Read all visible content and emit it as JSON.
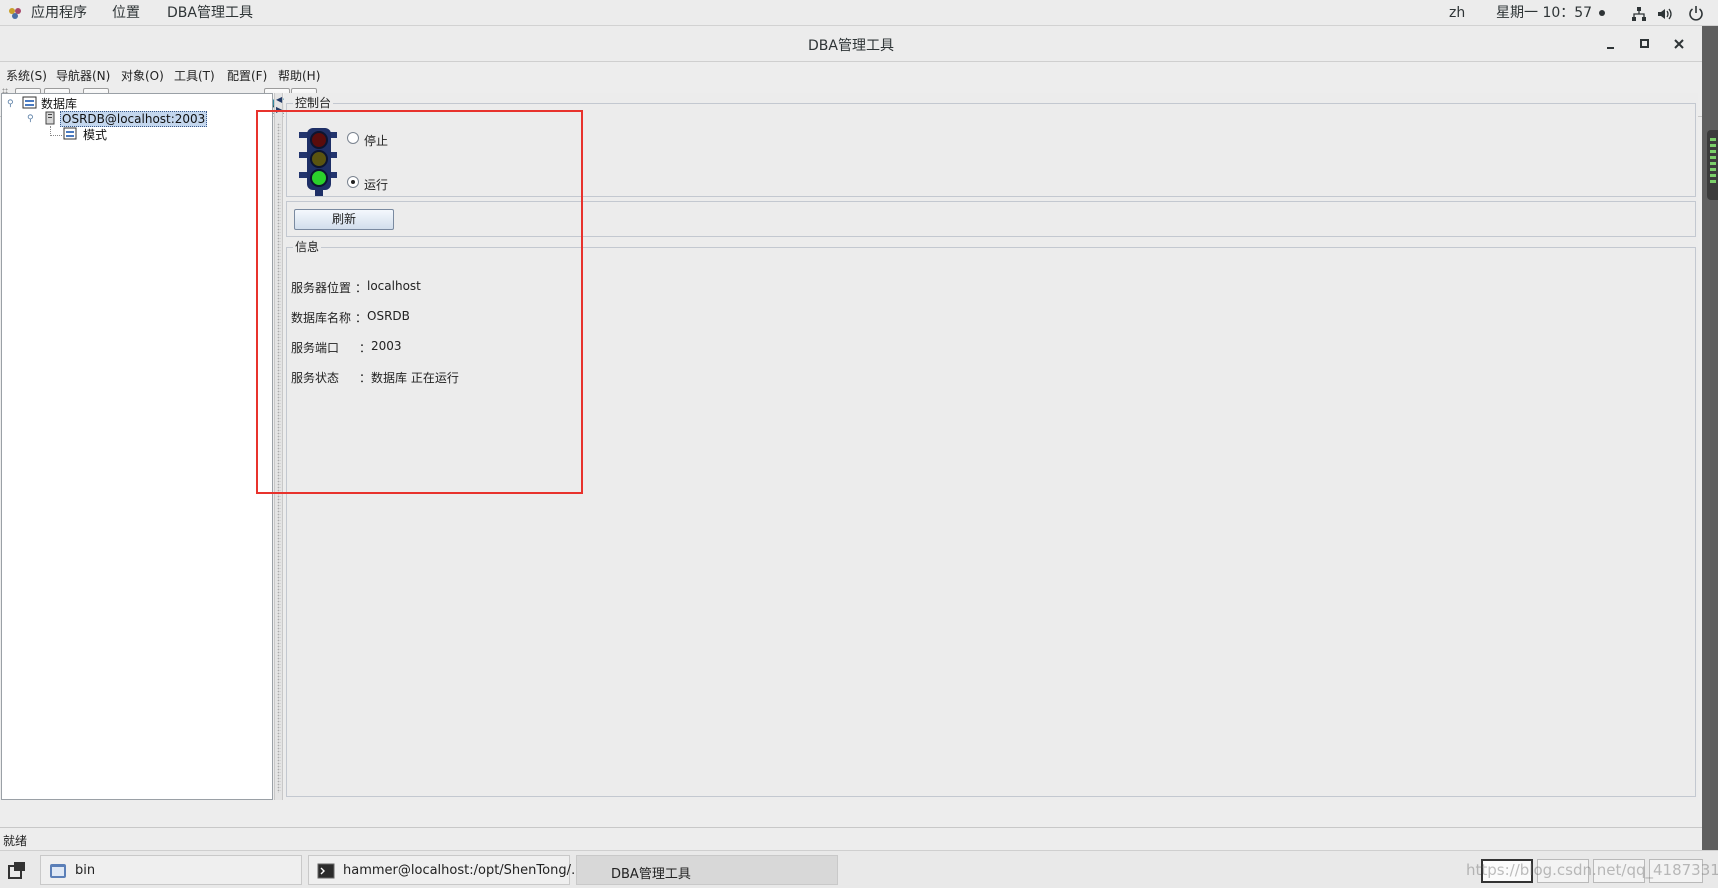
{
  "topbar": {
    "applications": "应用程序",
    "places": "位置",
    "active_app": "DBA管理工具",
    "lang": "zh",
    "clock": "星期一 10：57",
    "icons": [
      "network-icon",
      "volume-icon",
      "power-icon"
    ]
  },
  "window": {
    "title": "DBA管理工具",
    "controls": [
      "minimize",
      "maximize",
      "close"
    ]
  },
  "menu": {
    "items": [
      "系统(S)",
      "导航器(N)",
      "对象(O)",
      "工具(T)",
      "配置(F)",
      "帮助(H)"
    ]
  },
  "tree": {
    "root": "数据库",
    "server": "OSRDB@localhost:2003",
    "child": "模式"
  },
  "console": {
    "title": "控制台",
    "stop_label": "停止",
    "run_label": "运行",
    "selected": "运行",
    "refresh": "刷新"
  },
  "info": {
    "title": "信息",
    "rows": [
      {
        "key": "服务器位置",
        "colon": "：",
        "value": "localhost"
      },
      {
        "key": "数据库名称",
        "colon": "：",
        "value": "OSRDB"
      },
      {
        "key": "服务端口",
        "colon": "：",
        "value": "2003"
      },
      {
        "key": "服务状态",
        "colon": "：",
        "value": "数据库 正在运行"
      }
    ]
  },
  "status": "就绪",
  "taskbar": {
    "items": [
      "bin",
      "hammer@localhost:/opt/ShenTong/…",
      "DBA管理工具"
    ],
    "watermark": "https://blog.csdn.net/qq_41873311"
  },
  "colors": {
    "highlight": "#e8322c",
    "selection": "#c4d7ee"
  }
}
